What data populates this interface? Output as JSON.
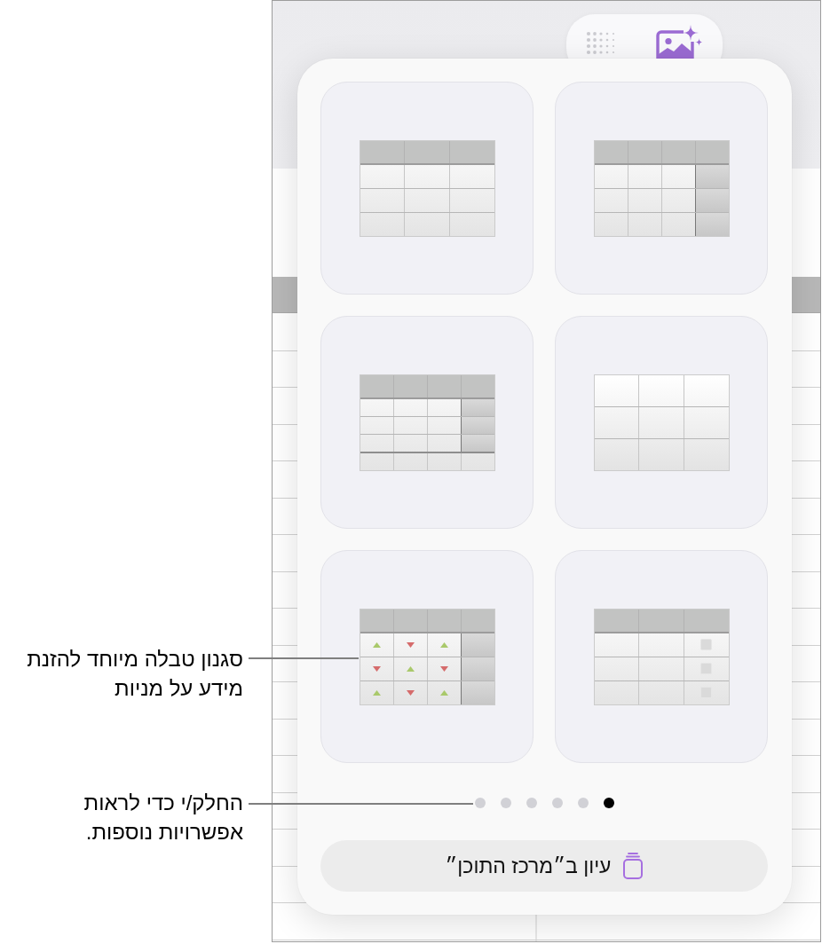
{
  "table_styles": [
    {
      "kind": "headers"
    },
    {
      "kind": "basic"
    },
    {
      "kind": "plain"
    },
    {
      "kind": "footer"
    },
    {
      "kind": "checkbox"
    },
    {
      "kind": "stocks"
    }
  ],
  "page_indicator": {
    "pages": [
      {
        "selected": true
      },
      {
        "selected": false
      },
      {
        "selected": false
      },
      {
        "selected": false
      },
      {
        "selected": false
      },
      {
        "selected": false
      }
    ]
  },
  "content_center_button": {
    "label": "עיון ב״מרכז התוכן״"
  },
  "callouts": [
    {
      "text": "סגנון טבלה מיוחד להזנת מידע על מניות"
    },
    {
      "text": "החלק/י כדי לראות אפשרויות נוספות."
    }
  ]
}
